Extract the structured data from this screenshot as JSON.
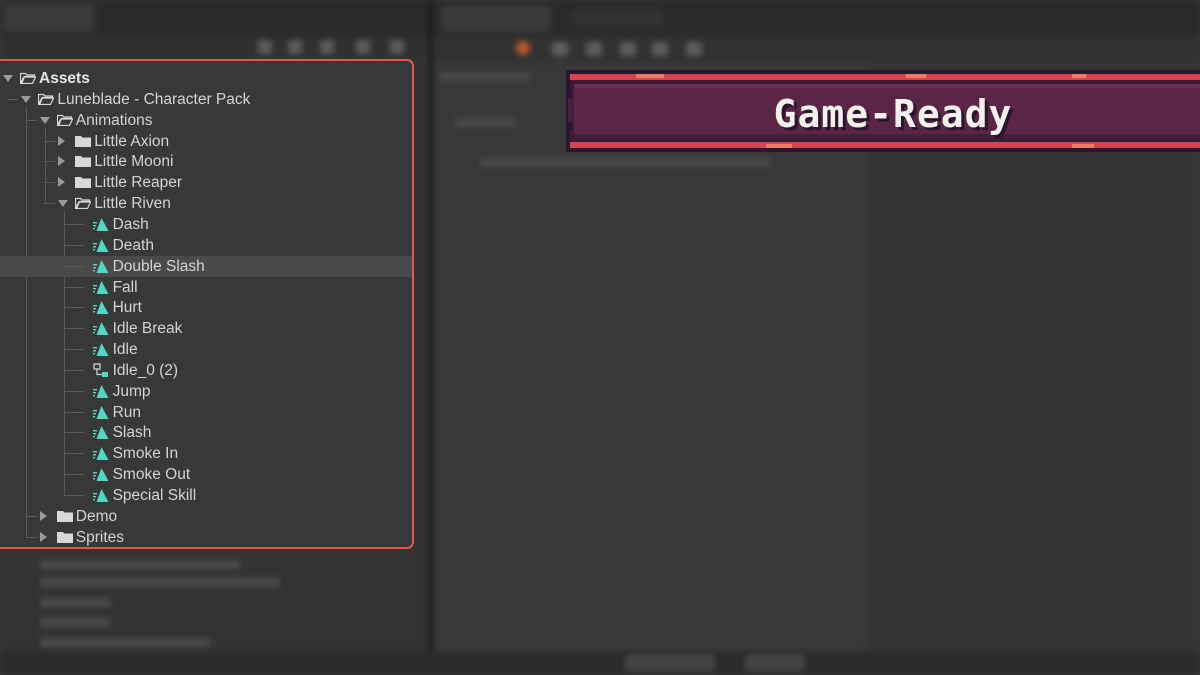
{
  "banner": {
    "text": "Game-Ready"
  },
  "tree": {
    "items": [
      {
        "label": "Assets",
        "depth": 0,
        "kind": "folder-open",
        "expanded": true,
        "bold": true
      },
      {
        "label": "Luneblade - Character Pack",
        "depth": 1,
        "kind": "folder-open",
        "expanded": true
      },
      {
        "label": "Animations",
        "depth": 2,
        "kind": "folder-open",
        "expanded": true
      },
      {
        "label": "Little Axion",
        "depth": 3,
        "kind": "folder",
        "expanded": false
      },
      {
        "label": "Little Mooni",
        "depth": 3,
        "kind": "folder",
        "expanded": false
      },
      {
        "label": "Little Reaper",
        "depth": 3,
        "kind": "folder",
        "expanded": false
      },
      {
        "label": "Little Riven",
        "depth": 3,
        "kind": "folder-open",
        "expanded": true
      },
      {
        "label": "Dash",
        "depth": 4,
        "kind": "animation-clip"
      },
      {
        "label": "Death",
        "depth": 4,
        "kind": "animation-clip"
      },
      {
        "label": "Double Slash",
        "depth": 4,
        "kind": "animation-clip",
        "selected": true
      },
      {
        "label": "Fall",
        "depth": 4,
        "kind": "animation-clip"
      },
      {
        "label": "Hurt",
        "depth": 4,
        "kind": "animation-clip"
      },
      {
        "label": "Idle Break",
        "depth": 4,
        "kind": "animation-clip"
      },
      {
        "label": "Idle",
        "depth": 4,
        "kind": "animation-clip"
      },
      {
        "label": "Idle_0 (2)",
        "depth": 4,
        "kind": "animator-controller"
      },
      {
        "label": "Jump",
        "depth": 4,
        "kind": "animation-clip"
      },
      {
        "label": "Run",
        "depth": 4,
        "kind": "animation-clip"
      },
      {
        "label": "Slash",
        "depth": 4,
        "kind": "animation-clip"
      },
      {
        "label": "Smoke In",
        "depth": 4,
        "kind": "animation-clip"
      },
      {
        "label": "Smoke Out",
        "depth": 4,
        "kind": "animation-clip"
      },
      {
        "label": "Special Skill",
        "depth": 4,
        "kind": "animation-clip"
      },
      {
        "label": "Demo",
        "depth": 2,
        "kind": "folder",
        "expanded": false
      },
      {
        "label": "Sprites",
        "depth": 2,
        "kind": "folder",
        "expanded": false
      }
    ]
  },
  "colors": {
    "highlight_border": "#e0584a",
    "clip_icon": "#4fd8c4",
    "banner_fill": "#5a2546",
    "banner_accent": "#e0444e"
  }
}
